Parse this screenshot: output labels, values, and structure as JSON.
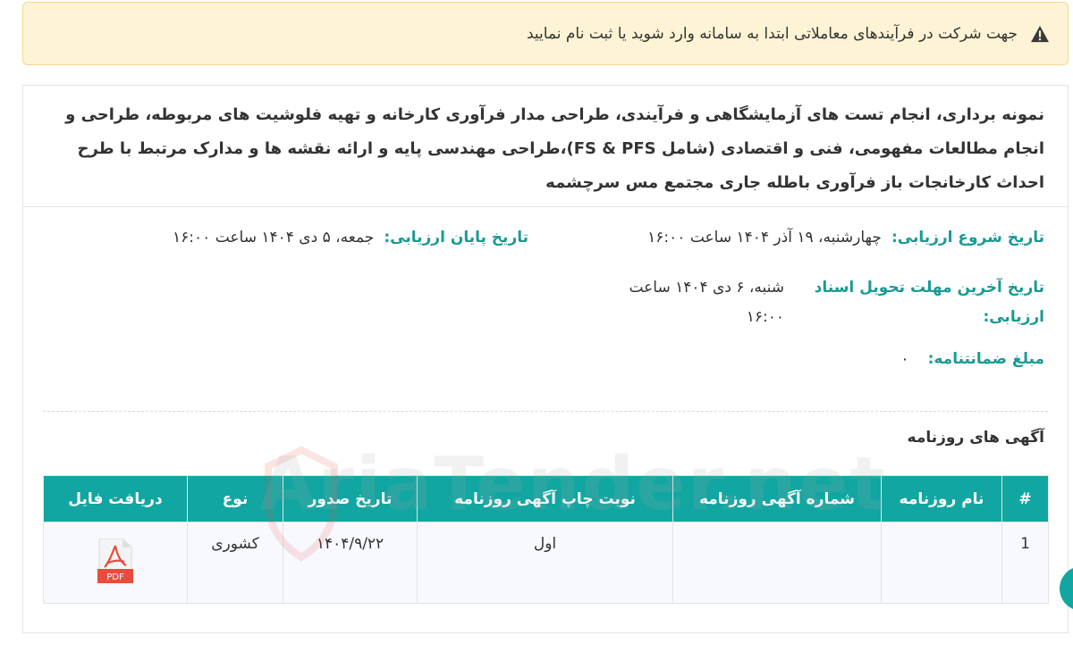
{
  "alert": {
    "text": "جهت شرکت در فرآیندهای معاملاتی ابتدا به سامانه وارد شوید یا ثبت نام نمایید",
    "icon": "warning-triangle-icon"
  },
  "tender": {
    "title": "نمونه برداری، انجام تست های آزمایشگاهی و فرآیندی، طراحی مدار فرآوری کارخانه و تهیه فلوشیت های مربوطه، طراحی و انجام مطالعات مفهومی، فنی و اقتصادی (شامل FS & PFS)،طراحی مهندسی پایه و ارائه نقشه ها و مدارک مرتبط با طرح احداث کارخانجات باز فرآوری باطله جاری مجتمع مس سرچشمه",
    "start_label": "تاریخ شروع ارزیابی:",
    "start_value": "چهارشنبه، ۱۹ آذر ۱۴۰۴ ساعت ۱۶:۰۰",
    "end_label": "تاریخ پایان ارزیابی:",
    "end_value": "جمعه، ۵ دی ۱۴۰۴ ساعت ۱۶:۰۰",
    "docs_label_line1": "تاریخ آخرین مهلت تحویل اسناد",
    "docs_label_line2": "ارزیابی:",
    "docs_value_line1": "شنبه، ۶ دی ۱۴۰۴ ساعت",
    "docs_value_line2": "۱۶:۰۰",
    "guarantee_label": "مبلغ ضمانتنامه:",
    "guarantee_value": "۰"
  },
  "ads": {
    "section_title": "آگهی های روزنامه",
    "columns": [
      "#",
      "نام روزنامه",
      "شماره آگهی روزنامه",
      "نوبت چاپ آگهی روزنامه",
      "تاریخ صدور",
      "نوع",
      "دریافت فایل"
    ],
    "rows": [
      {
        "index": "1",
        "newspaper": "",
        "ad_number": "",
        "round": "اول",
        "issue_date": "۱۴۰۴/۹/۲۲",
        "type": "کشوری",
        "file_badge": "PDF"
      }
    ]
  },
  "watermark": {
    "text": "AriaTender.net"
  },
  "colors": {
    "accent": "#11a6a1",
    "label": "#1a9a95",
    "alert_bg": "#fef4d5",
    "pdf_red": "#e84c3d"
  }
}
